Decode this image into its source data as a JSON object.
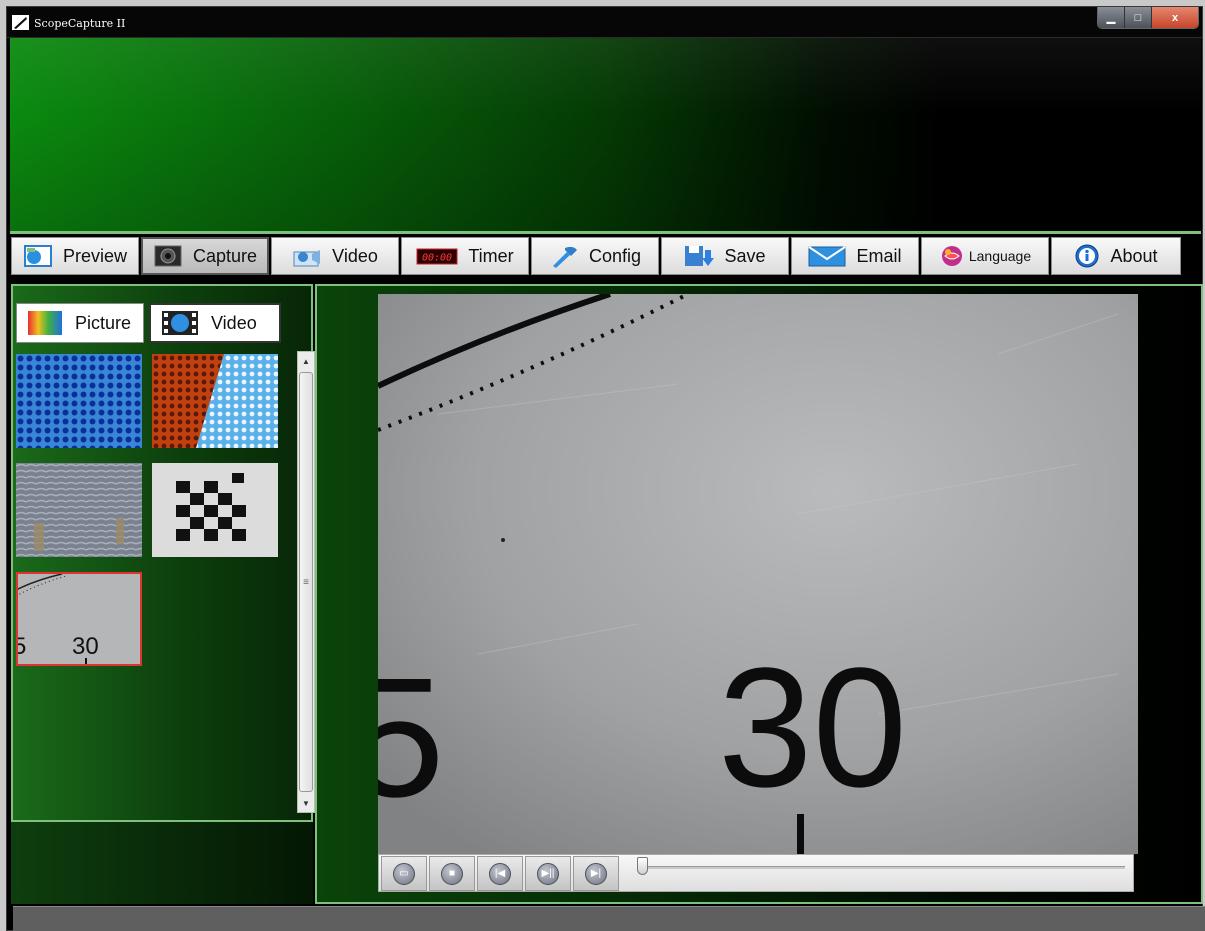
{
  "window": {
    "title": "ScopeCapture II",
    "controls": {
      "minimize": "▁",
      "maximize": "□",
      "close": "x"
    }
  },
  "toolbar": {
    "active": "Capture",
    "buttons": [
      {
        "label": "Preview",
        "icon": "preview-icon"
      },
      {
        "label": "Capture",
        "icon": "capture-icon"
      },
      {
        "label": "Video",
        "icon": "video-camera-icon"
      },
      {
        "label": "Timer",
        "icon": "timer-icon",
        "icon_text": "00:00"
      },
      {
        "label": "Config",
        "icon": "config-icon"
      },
      {
        "label": "Save",
        "icon": "save-icon"
      },
      {
        "label": "Email",
        "icon": "email-icon"
      },
      {
        "label": "Language",
        "icon": "language-icon"
      },
      {
        "label": "About",
        "icon": "about-icon"
      }
    ]
  },
  "gallery": {
    "tabs": [
      {
        "label": "Picture",
        "icon": "picture-icon"
      },
      {
        "label": "Video",
        "icon": "video-film-icon"
      }
    ],
    "active_tab": "Video",
    "thumbnails": [
      {
        "name": "blue-dots"
      },
      {
        "name": "red-blue-dots"
      },
      {
        "name": "fabric-texture"
      },
      {
        "name": "checker-pattern"
      },
      {
        "name": "dial-30",
        "label": "30",
        "label_left": "5",
        "selected": true
      }
    ],
    "scrollbar": {
      "up": "▲",
      "down": "▼",
      "grip": "≡"
    }
  },
  "viewer": {
    "digit_large": "30",
    "digit_partial": "5"
  },
  "playback": {
    "buttons": [
      {
        "name": "open-file-button",
        "icon": "open-folder-icon",
        "glyph": "▭"
      },
      {
        "name": "stop-button",
        "icon": "stop-icon",
        "glyph": "■"
      },
      {
        "name": "previous-button",
        "icon": "skip-back-icon",
        "glyph": "|◀"
      },
      {
        "name": "play-pause-button",
        "icon": "play-pause-icon",
        "glyph": "▶||"
      },
      {
        "name": "next-button",
        "icon": "skip-forward-icon",
        "glyph": "▶|"
      }
    ],
    "position": 0
  },
  "colors": {
    "accent_green": "#7fc07f",
    "selected_outline": "#dd3333",
    "toolbar_bg": "#f0f0f0"
  }
}
